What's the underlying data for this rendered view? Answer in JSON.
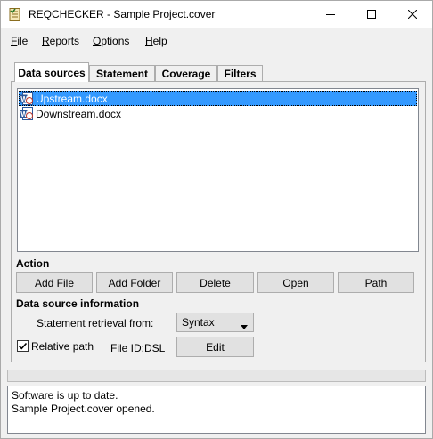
{
  "window": {
    "title": "REQCHECKER - Sample Project.cover",
    "minimize_icon": "minimize-icon",
    "maximize_icon": "maximize-icon",
    "close_icon": "close-icon"
  },
  "menu": [
    {
      "label": "File",
      "accel": "F",
      "rest": "ile"
    },
    {
      "label": "Reports",
      "accel": "R",
      "rest": "eports"
    },
    {
      "label": "Options",
      "accel": "O",
      "rest": "ptions"
    },
    {
      "label": "Help",
      "accel": "H",
      "rest": "elp"
    }
  ],
  "tabs": [
    {
      "label": "Data sources",
      "active": true
    },
    {
      "label": "Statement",
      "active": false
    },
    {
      "label": "Coverage",
      "active": false
    },
    {
      "label": "Filters",
      "active": false
    }
  ],
  "data_sources": {
    "files": [
      {
        "name": "Upstream.docx",
        "selected": true,
        "icon": "word-document-icon"
      },
      {
        "name": "Downstream.docx",
        "selected": false,
        "icon": "word-document-icon"
      }
    ],
    "action_label": "Action",
    "buttons": {
      "add_file": "Add File",
      "add_folder": "Add Folder",
      "delete": "Delete",
      "open": "Open",
      "path": "Path"
    },
    "info_label": "Data source information",
    "retrieval_label": "Statement retrieval from:",
    "retrieval_value": "Syntax",
    "relative_path_label": "Relative path",
    "relative_path_checked": true,
    "file_id_label": "File ID:DSL",
    "edit_button": "Edit"
  },
  "progress": {
    "value": 0
  },
  "log": [
    "Software is up to date.",
    "Sample Project.cover opened."
  ],
  "colors": {
    "selection": "#3399ff",
    "window_bg": "#f0f0f0",
    "button_bg": "#e1e1e1"
  }
}
